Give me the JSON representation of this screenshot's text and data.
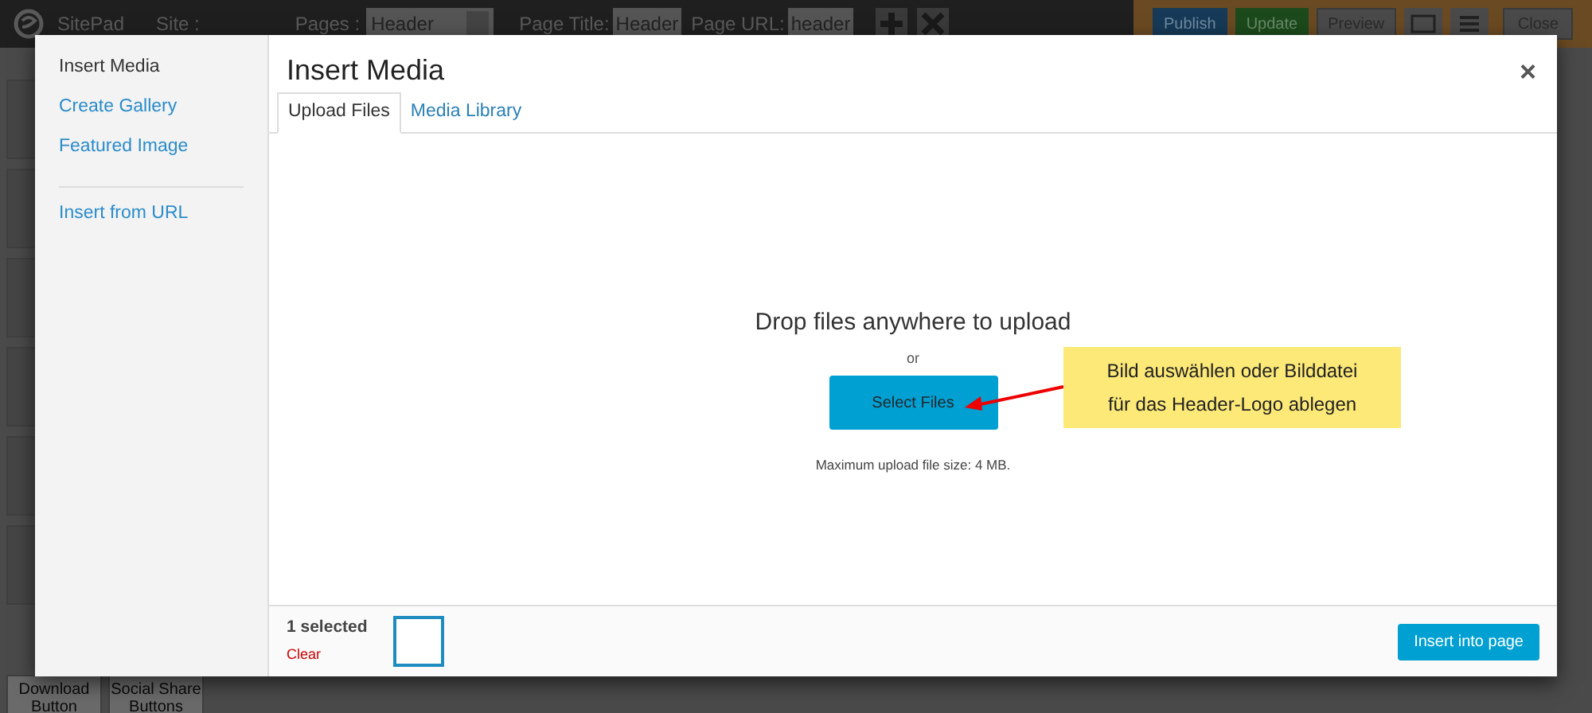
{
  "topbar": {
    "brand": "SitePad",
    "site_label": "Site :",
    "pages_label": "Pages :",
    "pages_value": "Header",
    "title_label": "Page Title:",
    "title_value": "Header",
    "url_label": "Page URL:",
    "url_value": "header",
    "actions": [
      {
        "label": "Publish",
        "kind": "publish"
      },
      {
        "label": "Update",
        "kind": "update"
      },
      {
        "label": "Preview",
        "kind": "plain"
      },
      {
        "label": "Close",
        "kind": "plain"
      }
    ]
  },
  "background_tiles": [
    {
      "label": "Download Button"
    },
    {
      "label": "Social Share Buttons"
    }
  ],
  "modal": {
    "title": "Insert Media",
    "close": "×",
    "sidebar": [
      {
        "label": "Insert Media",
        "selected": true
      },
      {
        "label": "Create Gallery",
        "selected": false
      },
      {
        "label": "Featured Image",
        "selected": false
      },
      {
        "label": "Insert from URL",
        "selected": false
      }
    ],
    "tabs": [
      {
        "label": "Upload Files",
        "selected": true
      },
      {
        "label": "Media Library",
        "selected": false
      }
    ],
    "upload": {
      "heading": "Drop files anywhere to upload",
      "or": "or",
      "button": "Select Files",
      "note": "Maximum upload file size: 4 MB."
    },
    "annotation": {
      "text": "Bild auswählen oder Bilddatei für das Header-Logo ablegen"
    },
    "footer": {
      "count": "1 selected",
      "clear": "Clear",
      "insert": "Insert into page"
    }
  }
}
